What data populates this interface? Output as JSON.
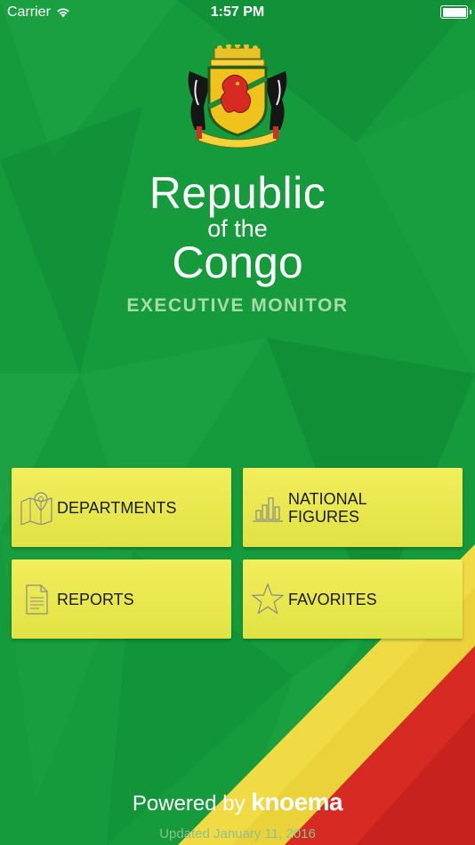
{
  "status_bar": {
    "carrier": "Carrier",
    "time": "1:57 PM"
  },
  "header": {
    "title_line1": "Republic",
    "title_line2": "of the",
    "title_line3": "Congo",
    "subtitle": "EXECUTIVE MONITOR"
  },
  "menu": [
    {
      "label": "DEPARTMENTS",
      "icon": "map-pin-icon"
    },
    {
      "label": "NATIONAL\nFIGURES",
      "icon": "bar-chart-icon"
    },
    {
      "label": "REPORTS",
      "icon": "document-icon"
    },
    {
      "label": "FAVORITES",
      "icon": "star-icon"
    }
  ],
  "footer": {
    "powered_by": "Powered by",
    "brand": "knoema",
    "updated": "Updated January 11, 2016"
  },
  "colors": {
    "green": "#159a3c",
    "yellow": "#f2ee5b",
    "red": "#d62a23"
  }
}
